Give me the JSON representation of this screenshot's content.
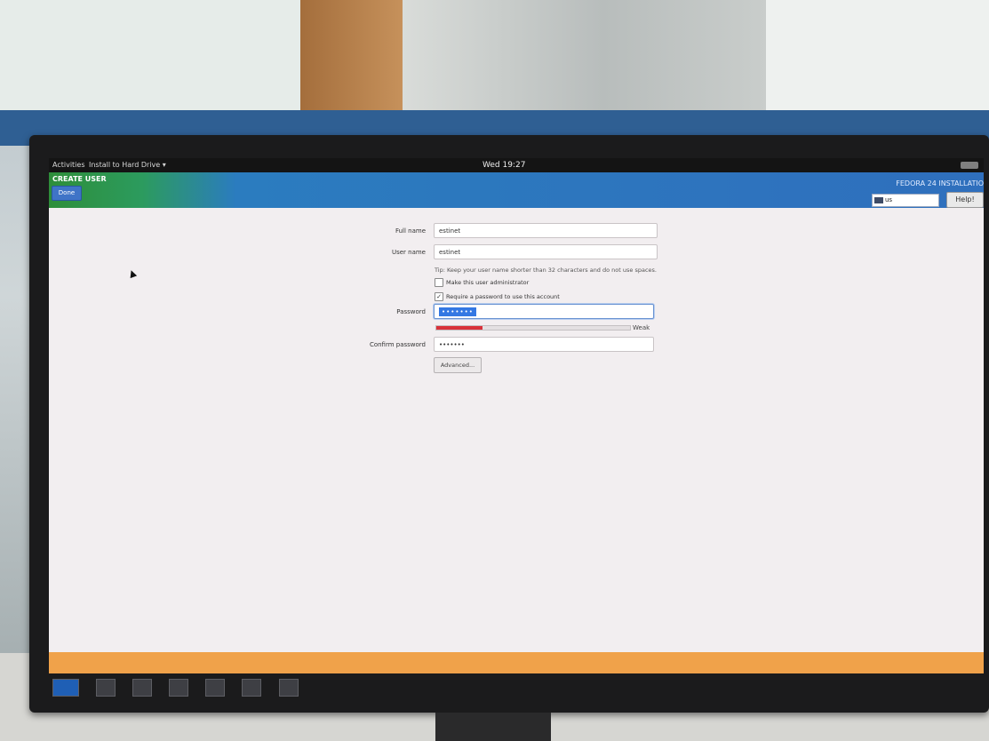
{
  "topbar": {
    "activities": "Activities",
    "app_menu": "Install to Hard Drive ▾",
    "clock": "Wed 19:27"
  },
  "header": {
    "spoke_title": "CREATE USER",
    "done_label": "Done",
    "product_title": "FEDORA 24 INSTALLATIO",
    "keyboard_layout": "us",
    "help_label": "Help!"
  },
  "form": {
    "full_name_label": "Full name",
    "full_name_value": "estinet",
    "user_name_label": "User name",
    "user_name_value": "estinet",
    "tip": "Tip: Keep your user name shorter than 32 characters and do not use spaces.",
    "admin_checkbox_label": "Make this user administrator",
    "admin_checked": false,
    "require_password_label": "Require a password to use this account",
    "require_password_checked": true,
    "password_label": "Password",
    "password_value": "•••••••",
    "strength_label": "Weak",
    "strength_fraction": 0.24,
    "confirm_label": "Confirm password",
    "confirm_value": "•••••••",
    "advanced_label": "Advanced..."
  },
  "warning_bar": {
    "text": ""
  },
  "colors": {
    "header_blue": "#2f6fbd",
    "header_green": "#2e8e3a",
    "warning_orange": "#f0a24a",
    "strength_red": "#d8313a"
  }
}
